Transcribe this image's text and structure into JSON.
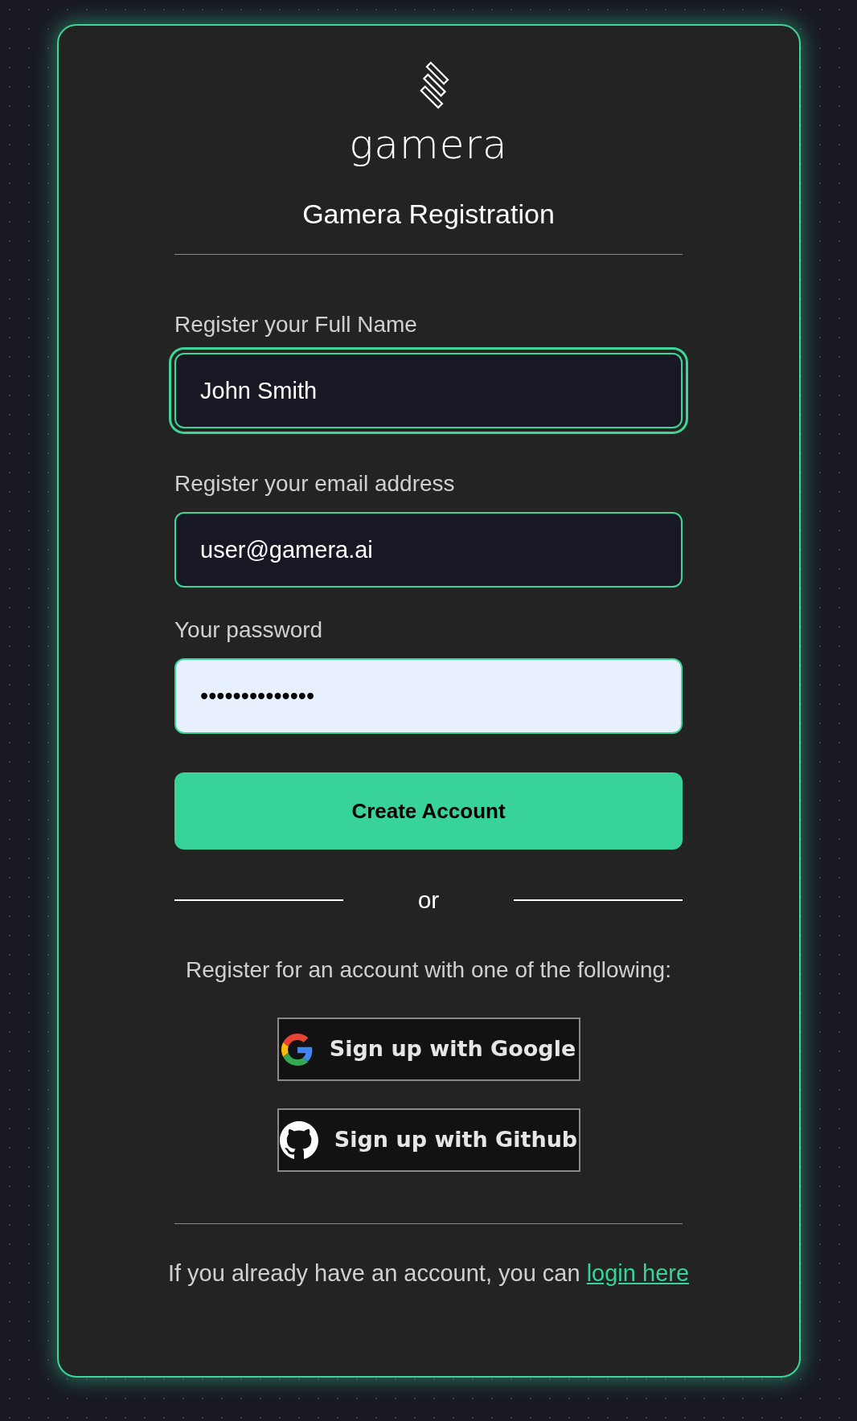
{
  "logo": {
    "wordmark": "gamera"
  },
  "title": "Gamera Registration",
  "fields": [
    {
      "label": "Register your Full Name",
      "value": "John Smith",
      "focused": true,
      "autofilled": false
    },
    {
      "label": "Register your email address",
      "value": "user@gamera.ai",
      "focused": false,
      "autofilled": false
    },
    {
      "label": "Your password",
      "value": "••••••••••••••",
      "focused": false,
      "autofilled": true
    }
  ],
  "submit_button": "Create Account",
  "separator": "or",
  "social_prompt": "Register for an account with one of the following:",
  "social_buttons": [
    {
      "kind": "google",
      "label": "Sign up with Google"
    },
    {
      "kind": "github",
      "label": "Sign up with Github"
    }
  ],
  "footer": {
    "text": "If you already have an account, you can",
    "link": "login here"
  }
}
